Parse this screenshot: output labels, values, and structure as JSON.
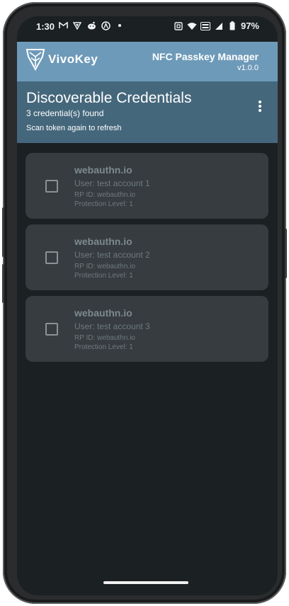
{
  "status_bar": {
    "time": "1:30",
    "left_icons": [
      "gmail-icon",
      "vpn-icon",
      "reddit-icon",
      "circle-a-icon",
      "dot-icon"
    ],
    "right_icons": [
      "nfc-icon",
      "wifi-icon",
      "vowifi-icon",
      "signal-icon",
      "battery-icon"
    ],
    "battery": "97%"
  },
  "app_bar": {
    "logo_text": "VivoKey",
    "title": "NFC Passkey Manager",
    "version": "v1.0.0",
    "color": "#6e9ab9"
  },
  "header": {
    "title": "Discoverable Credentials",
    "count": "3 credential(s) found",
    "hint": "Scan token again to refresh",
    "color": "#45677c"
  },
  "credentials": [
    {
      "rp": "webauthn.io",
      "user": "User: test account 1",
      "rp_id": "RP ID: webauthn.io",
      "protection": "Protection Level: 1"
    },
    {
      "rp": "webauthn.io",
      "user": "User: test account 2",
      "rp_id": "RP ID: webauthn.io",
      "protection": "Protection Level: 1"
    },
    {
      "rp": "webauthn.io",
      "user": "User: test account 3",
      "rp_id": "RP ID: webauthn.io",
      "protection": "Protection Level: 1"
    }
  ]
}
